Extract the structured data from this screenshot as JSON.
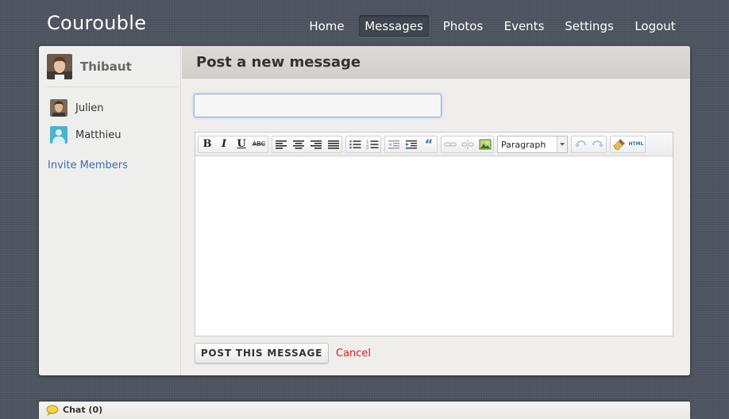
{
  "app": {
    "title": "Courouble"
  },
  "nav": {
    "items": [
      {
        "label": "Home"
      },
      {
        "label": "Messages",
        "active": true
      },
      {
        "label": "Photos"
      },
      {
        "label": "Events"
      },
      {
        "label": "Settings"
      },
      {
        "label": "Logout"
      }
    ]
  },
  "sidebar": {
    "user": {
      "name": "Thibaut",
      "avatar_icon": "user-avatar-photo"
    },
    "members": [
      {
        "name": "Julien",
        "avatar_icon": "user-avatar-photo"
      },
      {
        "name": "Matthieu",
        "avatar_icon": "default-avatar-icon"
      }
    ],
    "invite_label": "Invite Members"
  },
  "compose": {
    "title": "Post a new message",
    "subject_value": "",
    "subject_placeholder": "",
    "format_select": {
      "selected": "Paragraph"
    },
    "editor_content": "",
    "post_label": "POST THIS MESSAGE",
    "cancel_label": "Cancel"
  },
  "toolbar": {
    "buttons": [
      "bold-icon",
      "italic-icon",
      "underline-icon",
      "strikethrough-icon",
      "align-left-icon",
      "align-center-icon",
      "align-right-icon",
      "align-justify-icon",
      "bulleted-list-icon",
      "numbered-list-icon",
      "outdent-icon",
      "indent-icon",
      "blockquote-icon",
      "link-icon",
      "unlink-icon",
      "image-icon",
      "undo-icon",
      "redo-icon",
      "cleanup-icon",
      "html-source-icon"
    ],
    "html_label": "HTML"
  },
  "chat": {
    "label": "Chat (0)",
    "icon": "chat-bubble-icon"
  },
  "colors": {
    "background": "#4e5560",
    "accent_link": "#3a6db5",
    "cancel": "#e01818",
    "input_focus": "#8fb0e0"
  }
}
